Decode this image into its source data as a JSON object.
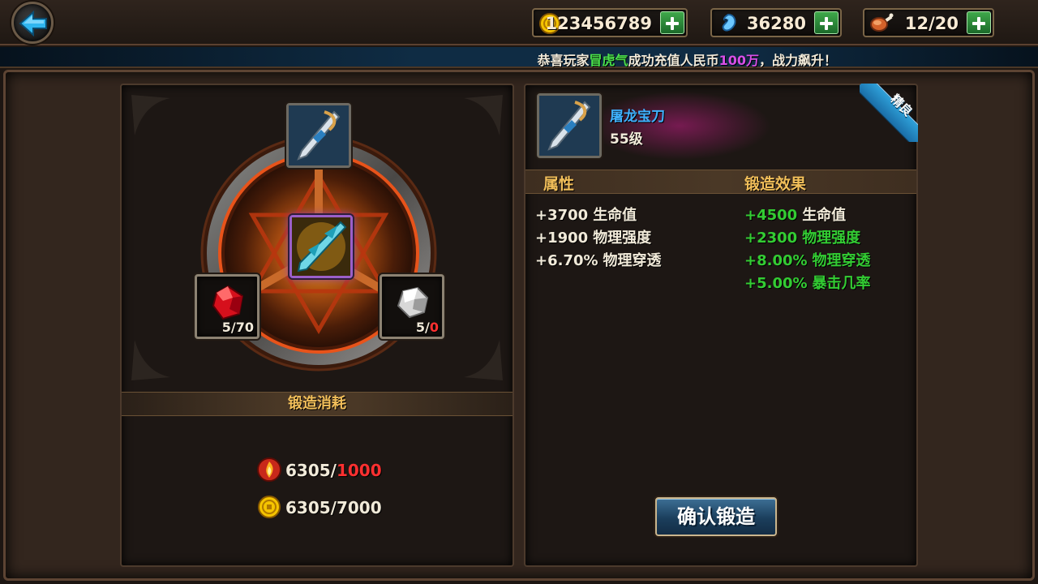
{
  "top_bar": {
    "back_icon": "back-arrow-icon",
    "resources": [
      {
        "name": "gold",
        "icon": "gold-coin-icon",
        "value": "123456789"
      },
      {
        "name": "soul",
        "icon": "blue-soul-icon",
        "value": "36280"
      },
      {
        "name": "stamina",
        "icon": "meat-drumstick-icon",
        "value": "12/20"
      }
    ]
  },
  "banner": {
    "prefix": "恭喜玩家",
    "player": "冒虎气",
    "middle": "成功充值人民币",
    "amount": "100万",
    "suffix": "，战力飙升！"
  },
  "forge": {
    "target_icon": "sword-blade-icon",
    "center_icon": "crystal-sword-icon",
    "materials": [
      {
        "icon": "red-gem-icon",
        "have": "5/",
        "need": "70"
      },
      {
        "icon": "silver-ore-icon",
        "have": "5/",
        "need": "0"
      }
    ],
    "cost_title": "锻造消耗",
    "costs": [
      {
        "icon": "fire-essence-icon",
        "have": "6305/",
        "need": "1000",
        "need_color": "#ff3030"
      },
      {
        "icon": "gold-coin-icon",
        "have": "6305/",
        "need": "7000",
        "need_color": "#f1ead9"
      }
    ]
  },
  "item": {
    "name": "屠龙宝刀",
    "level": "55级",
    "quality_ribbon": "精良",
    "attr_title": "属性",
    "effect_title": "锻造效果",
    "base_stats": [
      {
        "num": "+3700",
        "label": "生命值"
      },
      {
        "num": "+1900",
        "label": "物理强度"
      },
      {
        "num": "+6.70%",
        "label": "物理穿透"
      }
    ],
    "forged_stats": [
      {
        "num": "+4500",
        "label": "生命值"
      },
      {
        "num": "+2300",
        "label": "物理强度"
      },
      {
        "num": "+8.00%",
        "label": "物理穿透"
      },
      {
        "num": "+5.00%",
        "label": "暴击几率"
      }
    ],
    "confirm_label": "确认锻造"
  },
  "colors": {
    "gold_text": "#f2bf5a",
    "green_stat": "#33cc33",
    "item_name_blue": "#3fb2ff",
    "warning_red": "#ff3030"
  }
}
